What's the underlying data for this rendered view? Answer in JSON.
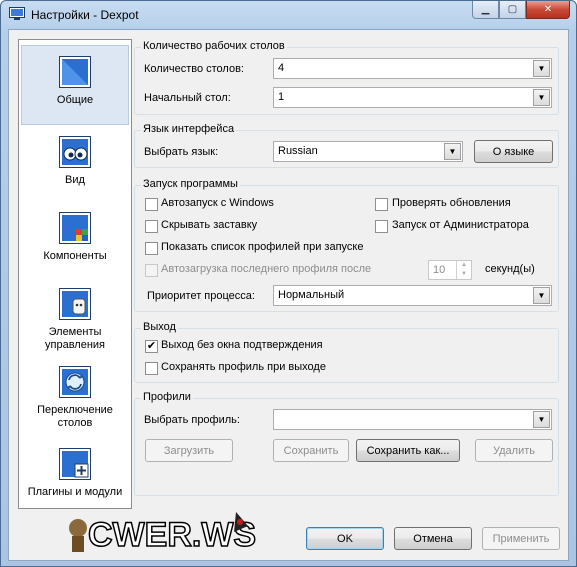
{
  "window": {
    "title": "Настройки - Dexpot",
    "min_icon": "minimize-icon",
    "max_icon": "maximize-icon",
    "close_icon": "close-icon"
  },
  "sidebar": {
    "items": [
      {
        "label": "Общие",
        "icon": "general-icon",
        "active": true
      },
      {
        "label": "Вид",
        "icon": "view-icon"
      },
      {
        "label": "Компоненты",
        "icon": "components-icon"
      },
      {
        "label": "Элементы управления",
        "line1": "Элементы",
        "line2": "управления",
        "icon": "controls-icon"
      },
      {
        "label": "Переключение столов",
        "line1": "Переключение",
        "line2": "столов",
        "icon": "switching-icon"
      },
      {
        "label": "Плагины и модули",
        "icon": "plugins-icon"
      }
    ]
  },
  "desktops": {
    "title": "Количество рабочих столов",
    "count_label": "Количество столов:",
    "count_value": "4",
    "start_label": "Начальный стол:",
    "start_value": "1"
  },
  "language": {
    "title": "Язык интерфейса",
    "select_label": "Выбрать язык:",
    "select_value": "Russian",
    "about_button": "О языке"
  },
  "startup": {
    "title": "Запуск программы",
    "autostart": "Автозапуск с Windows",
    "check_updates": "Проверять обновления",
    "hide_splash": "Скрывать заставку",
    "run_as_admin": "Запуск от Администратора",
    "show_profiles": "Показать список профилей при запуске",
    "autoload_last": "Автозагрузка последнего профиля после",
    "seconds_value": "10",
    "seconds_label": "секунд(ы)",
    "priority_label": "Приоритет процесса:",
    "priority_value": "Нормальный"
  },
  "exit": {
    "title": "Выход",
    "no_confirm": "Выход без окна подтверждения",
    "no_confirm_checked": true,
    "save_profile": "Сохранять профиль при выходе"
  },
  "profiles": {
    "title": "Профили",
    "select_label": "Выбрать профиль:",
    "select_value": "",
    "load_button": "Загрузить",
    "save_button": "Сохранить",
    "save_as_button": "Сохранить как...",
    "delete_button": "Удалить"
  },
  "footer": {
    "ok": "OK",
    "cancel": "Отмена",
    "apply": "Применить"
  },
  "watermark": {
    "text": "CWER.WS"
  }
}
